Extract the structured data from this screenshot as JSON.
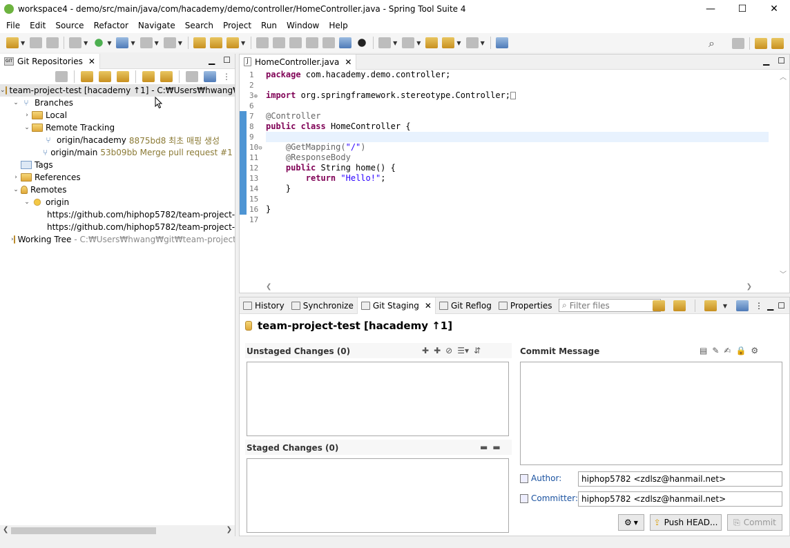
{
  "window": {
    "title": "workspace4 - demo/src/main/java/com/hacademy/demo/controller/HomeController.java - Spring Tool Suite 4",
    "minimize": "—",
    "maximize": "☐",
    "close": "✕"
  },
  "menu": [
    "File",
    "Edit",
    "Source",
    "Refactor",
    "Navigate",
    "Search",
    "Project",
    "Run",
    "Window",
    "Help"
  ],
  "git_repos": {
    "tab_label": "Git Repositories",
    "tab_icon_text": "GIT",
    "repo": "team-project-test [hacademy ↑1] - C:₩Users₩hwang₩g",
    "branches": "Branches",
    "local": "Local",
    "remote_tracking": "Remote Tracking",
    "rt_hacademy": "origin/hacademy",
    "rt_hacademy_info": "8875bd8 최초 매핑 생성",
    "rt_main": "origin/main",
    "rt_main_info": "53b09bb Merge pull request #1 fr",
    "tags": "Tags",
    "references": "References",
    "remotes": "Remotes",
    "origin": "origin",
    "fetch_url": "https://github.com/hiphop5782/team-project-",
    "push_url": "https://github.com/hiphop5782/team-project-",
    "working_tree": "Working Tree",
    "working_tree_info": "- C:₩Users₩hwang₩git₩team-project-t"
  },
  "editor": {
    "tab_label": "HomeController.java",
    "line_numbers": [
      "1",
      "2",
      "3",
      "6",
      "7",
      "8",
      "9",
      "10",
      "11",
      "12",
      "13",
      "14",
      "15",
      "16",
      "17"
    ],
    "lines": {
      "l1_kw": "package",
      "l1_rest": " com.hacademy.demo.controller;",
      "l3_kw": "import",
      "l3_rest": " org.springframework.stereotype.Controller;",
      "l7": "@Controller",
      "l8_kw1": "public",
      "l8_kw2": "class",
      "l8_rest": " HomeController {",
      "l10_an": "    @GetMapping(",
      "l10_str": "\"/\"",
      "l10_end": ")",
      "l11": "    @ResponseBody",
      "l12_kw": "    public",
      "l12_rest": " String home() {",
      "l13_kw": "        return",
      "l13_str": "\"Hello!\"",
      "l13_end": ";",
      "l14": "    }",
      "l16": "}"
    }
  },
  "bottom": {
    "tabs": {
      "history": "History",
      "synchronize": "Synchronize",
      "git_staging": "Git Staging",
      "git_reflog": "Git Reflog",
      "properties": "Properties"
    },
    "filter_placeholder": "Filter files",
    "repo_title": "team-project-test [hacademy ↑1]",
    "unstaged": "Unstaged Changes (0)",
    "staged": "Staged Changes (0)",
    "commit_message": "Commit Message",
    "author_label": "Author:",
    "author_value": "hiphop5782 <zdlsz@hanmail.net>",
    "committer_label": "Committer:",
    "committer_value": "hiphop5782 <zdlsz@hanmail.net>",
    "push_button": "Push HEAD...",
    "commit_button": "Commit"
  }
}
